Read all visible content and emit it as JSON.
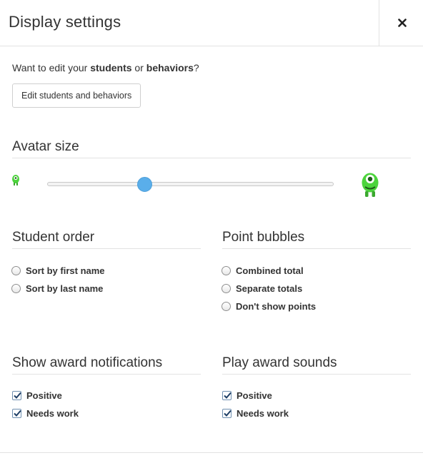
{
  "dialog": {
    "title": "Display settings",
    "close_icon": "close-icon"
  },
  "edit": {
    "prompt_prefix": "Want to edit your ",
    "prompt_students": "students",
    "prompt_or": " or ",
    "prompt_behaviors": "behaviors",
    "prompt_suffix": "?",
    "button_label": "Edit students and behaviors"
  },
  "avatar_size": {
    "title": "Avatar size",
    "slider_value_fraction": 0.34,
    "small_icon": "small-monster-avatar-icon",
    "large_icon": "large-monster-avatar-icon",
    "avatar_color": "#4cd43c",
    "thumb_color": "#5aaeea"
  },
  "student_order": {
    "title": "Student order",
    "options": [
      {
        "label": "Sort by first name",
        "selected": false
      },
      {
        "label": "Sort by last name",
        "selected": false
      }
    ]
  },
  "point_bubbles": {
    "title": "Point bubbles",
    "options": [
      {
        "label": "Combined total",
        "selected": false
      },
      {
        "label": "Separate totals",
        "selected": false
      },
      {
        "label": "Don't show points",
        "selected": false
      }
    ]
  },
  "award_notifications": {
    "title": "Show award notifications",
    "options": [
      {
        "label": "Positive",
        "checked": true
      },
      {
        "label": "Needs work",
        "checked": true
      }
    ]
  },
  "award_sounds": {
    "title": "Play award sounds",
    "options": [
      {
        "label": "Positive",
        "checked": true
      },
      {
        "label": "Needs work",
        "checked": true
      }
    ]
  }
}
